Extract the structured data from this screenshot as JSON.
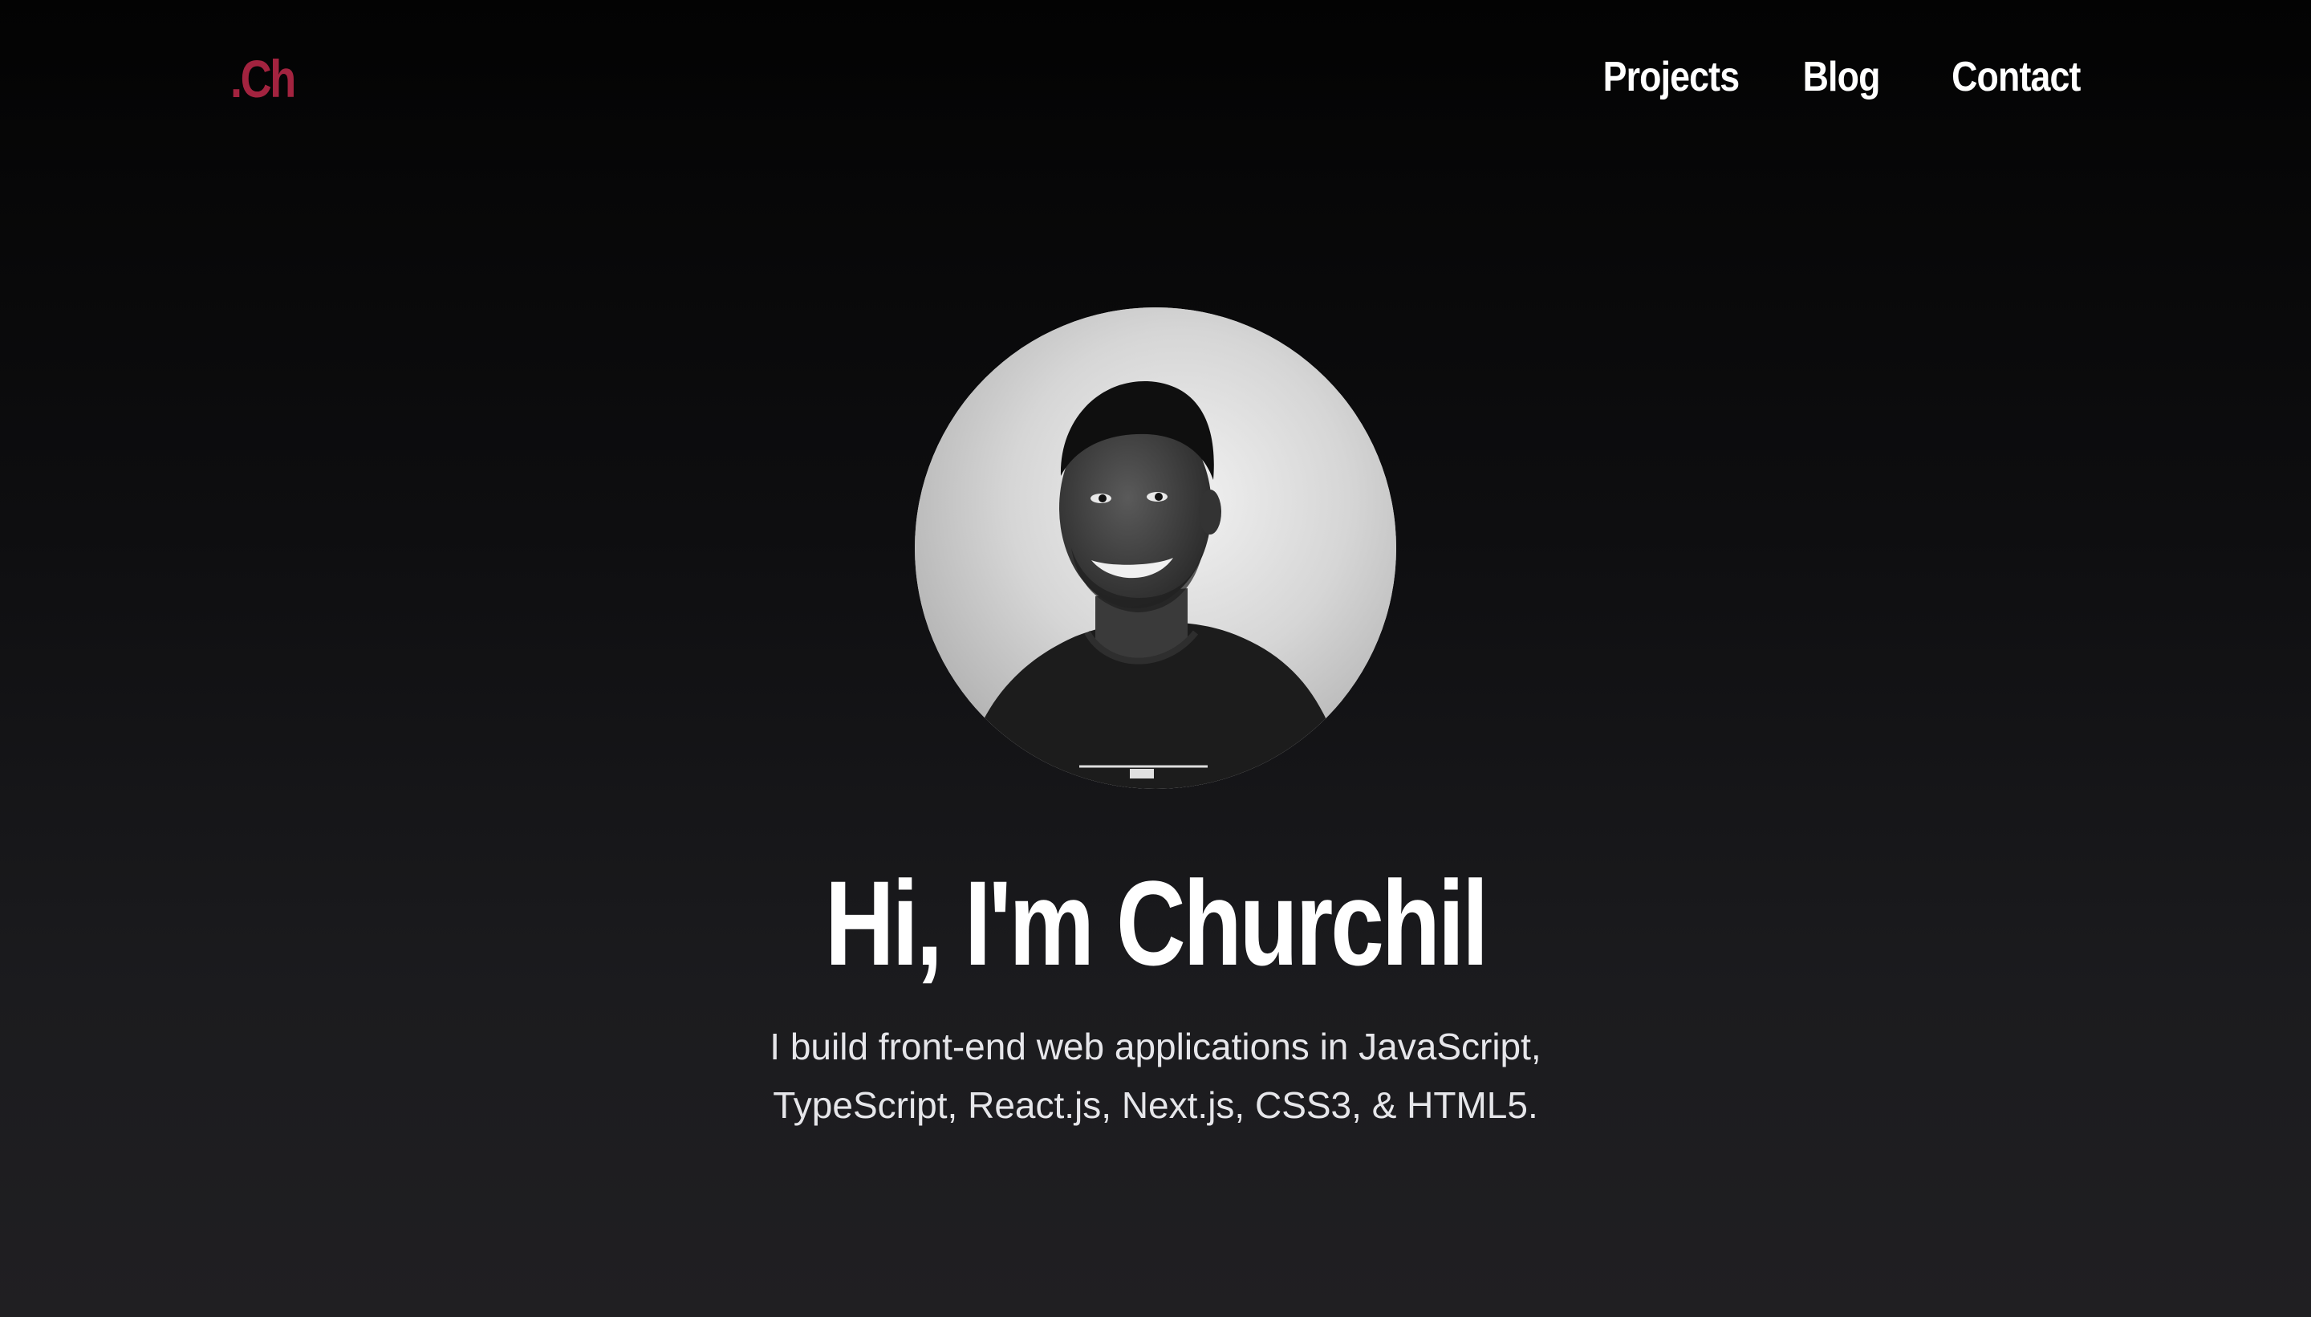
{
  "header": {
    "logo_text": ".Ch",
    "logo_color": "#a3233f",
    "nav": [
      {
        "label": "Projects"
      },
      {
        "label": "Blog"
      },
      {
        "label": "Contact"
      }
    ]
  },
  "hero": {
    "title": "Hi, I'm Churchil",
    "subtitle": "I build front-end web applications in JavaScript, TypeScript, React.js, Next.js, CSS3, & HTML5."
  },
  "colors": {
    "background_top": "#030303",
    "background_bottom": "#201f22",
    "text": "#ffffff",
    "subtitle": "#e6e6ea",
    "accent": "#a3233f"
  }
}
